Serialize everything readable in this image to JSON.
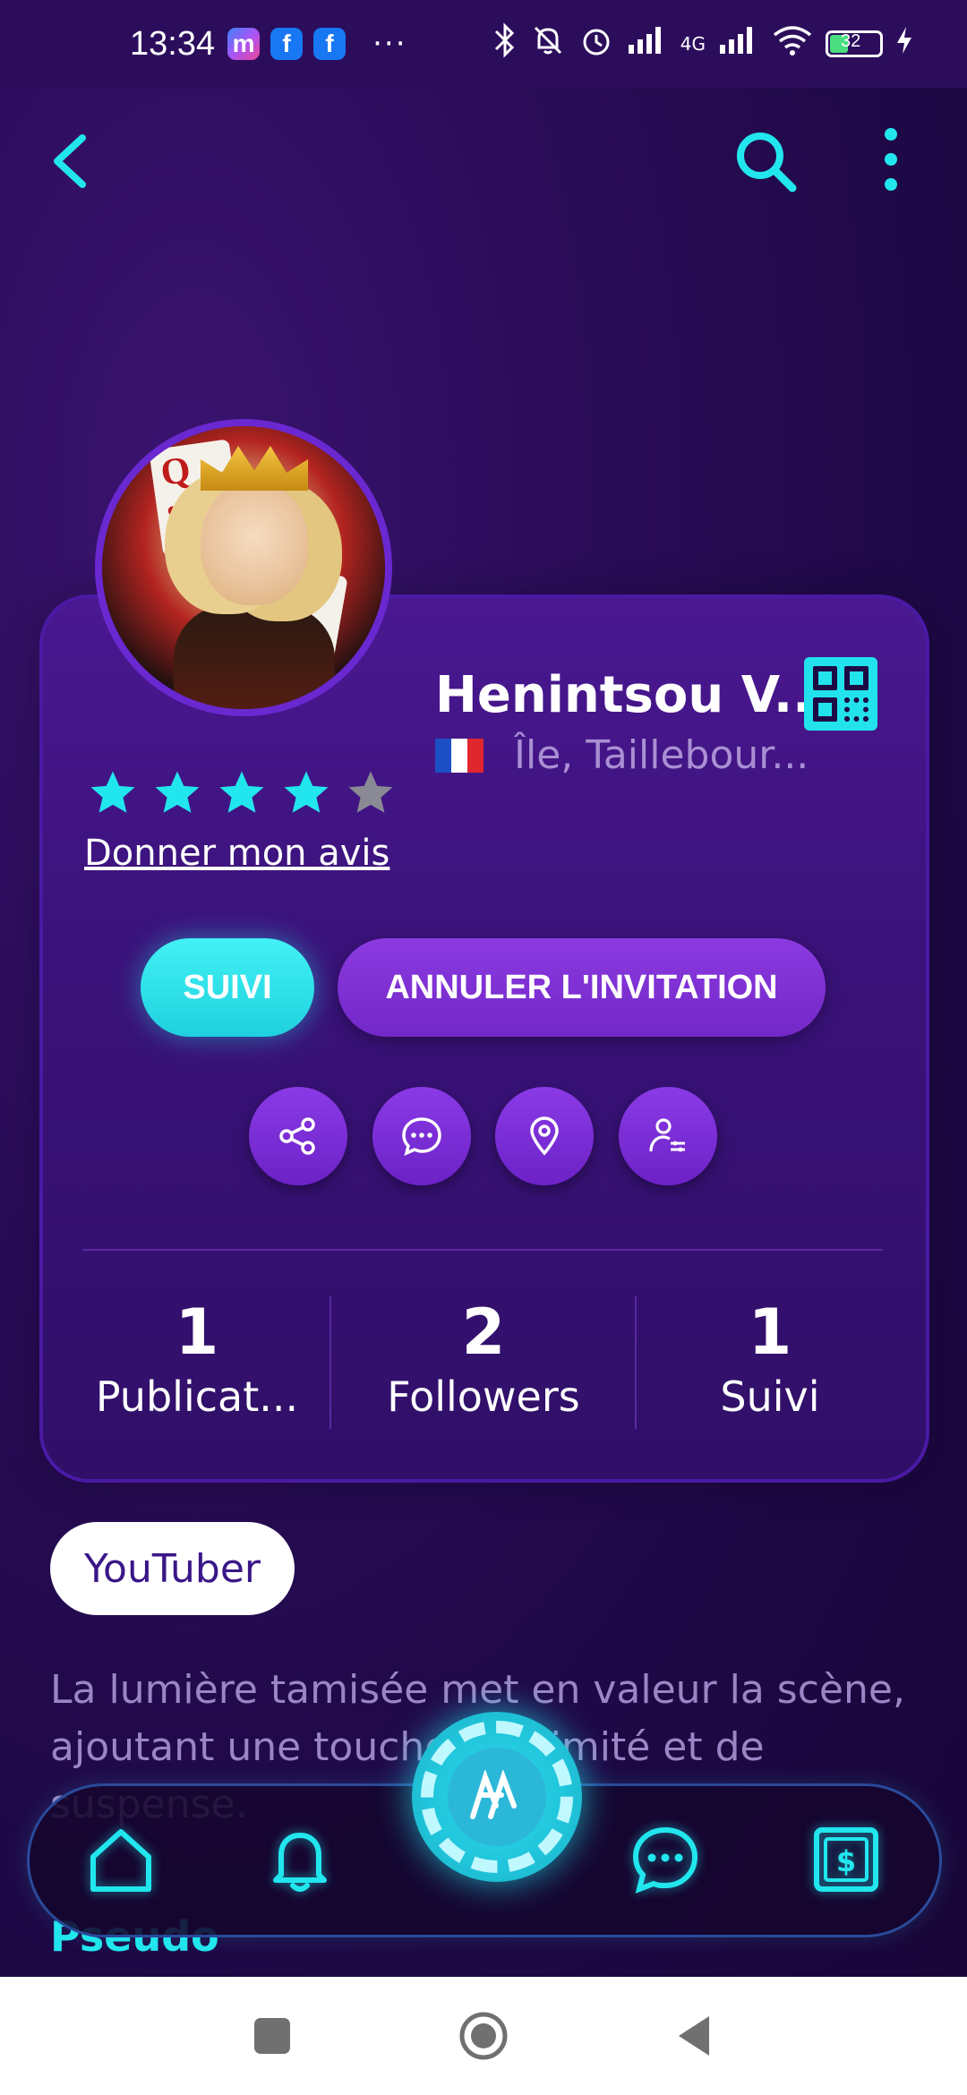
{
  "status_bar": {
    "time": "13:34",
    "apps": [
      "messenger-icon",
      "facebook-icon",
      "facebook-icon"
    ],
    "more": "···",
    "network": "4G",
    "battery": "32"
  },
  "profile": {
    "name": "Henintsou V...",
    "location": "Île, Taillebour...",
    "rating": 4,
    "rating_max": 5,
    "review_link": "Donner mon avis"
  },
  "actions": {
    "follow_label": "SUIVI",
    "cancel_label": "ANNULER L'INVITATION",
    "icon_buttons": [
      "share-icon",
      "chat-icon",
      "location-pin-icon",
      "user-settings-icon"
    ]
  },
  "stats": [
    {
      "value": "1",
      "label": "Publicat..."
    },
    {
      "value": "2",
      "label": "Followers"
    },
    {
      "value": "1",
      "label": "Suivi"
    }
  ],
  "tag": "YouTuber",
  "bio": "La lumière tamisée met en valeur la scène, ajoutant une touche d’intimité et de suspense.",
  "pseudo_label": "Pseudo",
  "bottom_nav": [
    "home-icon",
    "bell-icon",
    "poker-chip-icon",
    "chat-icon",
    "safe-icon"
  ],
  "colors": {
    "accent": "#22e6ee",
    "purple_button": "#7d30d6",
    "background": "#2a0c58"
  }
}
